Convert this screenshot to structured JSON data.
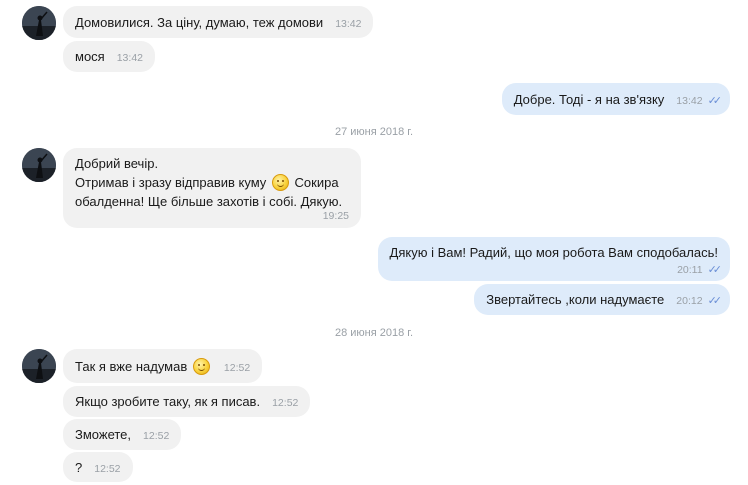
{
  "messages": [
    {
      "text": "Домовилися. За ціну, думаю, теж домови",
      "time": "13:42"
    },
    {
      "text": "мося",
      "time": "13:42"
    },
    {
      "text": "Добре. Тоді - я на зв'язку",
      "time": "13:42"
    },
    {
      "line1": "Добрий вечір.",
      "line2a": "Отримав і зразу відправив куму",
      "line2b": "Сокира",
      "line3": "обалденна! Ще більше захотів і собі. Дякую.",
      "time": "19:25"
    },
    {
      "text": "Дякую і Вам! Радий, що моя робота Вам сподобалась!",
      "time": "20:11"
    },
    {
      "text": "Звертайтесь ,коли надумаєте",
      "time": "20:12"
    },
    {
      "text": "Так я вже надумав",
      "time": "12:52"
    },
    {
      "text": "Якщо зробите таку, як я писав.",
      "time": "12:52"
    },
    {
      "text": "Зможете,",
      "time": "12:52"
    },
    {
      "text": "?",
      "time": "12:52"
    }
  ],
  "dates": [
    "27 июня 2018 г.",
    "28 июня 2018 г."
  ],
  "icons": {
    "read": "double-check-icon",
    "emoji": "smile-emoji-icon",
    "avatar": "user-avatar"
  },
  "colors": {
    "incoming": "#f1f1f1",
    "outgoing": "#deebfa",
    "check": "#6b8fd6"
  }
}
